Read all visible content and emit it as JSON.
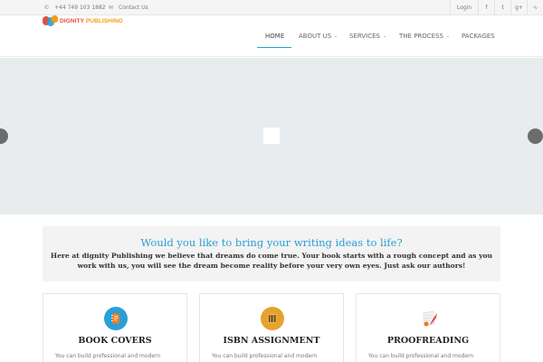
{
  "topbar": {
    "phone": "+44 749 103 1882",
    "contact": "Contact Us",
    "login": "Login",
    "social": [
      "facebook-icon",
      "twitter-icon",
      "google-plus-icon",
      "rss-icon"
    ]
  },
  "logo": {
    "part1": "DIGNITY ",
    "part2": "PUBLISHING"
  },
  "nav": {
    "home": "HOME",
    "about": "ABOUT US",
    "services": "SERVICES",
    "process": "THE PROCESS",
    "packages": "PACKAGES"
  },
  "intro": {
    "heading": "Would you like to bring your writing ideas to life?",
    "body": "Here at dignity Publishing we believe that dreams do come true. Your book starts with a rough concept and as you work with us, you will see the dream become reality before your very own eyes. Just ask our authors!"
  },
  "cards": [
    {
      "title": "BOOK COVERS",
      "desc": "You can build professional and modern",
      "icon": "notebook-icon",
      "color": "#2a9fd6"
    },
    {
      "title": "ISBN ASSIGNMENT",
      "desc": "You can build professional and modern",
      "icon": "barcode-icon",
      "color": "#e4a32d"
    },
    {
      "title": "PROOFREADING",
      "desc": "You can build professional and modern",
      "icon": "paper-quill-icon",
      "color": "#f0f0f0"
    }
  ],
  "colors": {
    "accent": "#2a9fd6",
    "logo_red": "#e74c3c",
    "logo_orange": "#f39c12"
  }
}
